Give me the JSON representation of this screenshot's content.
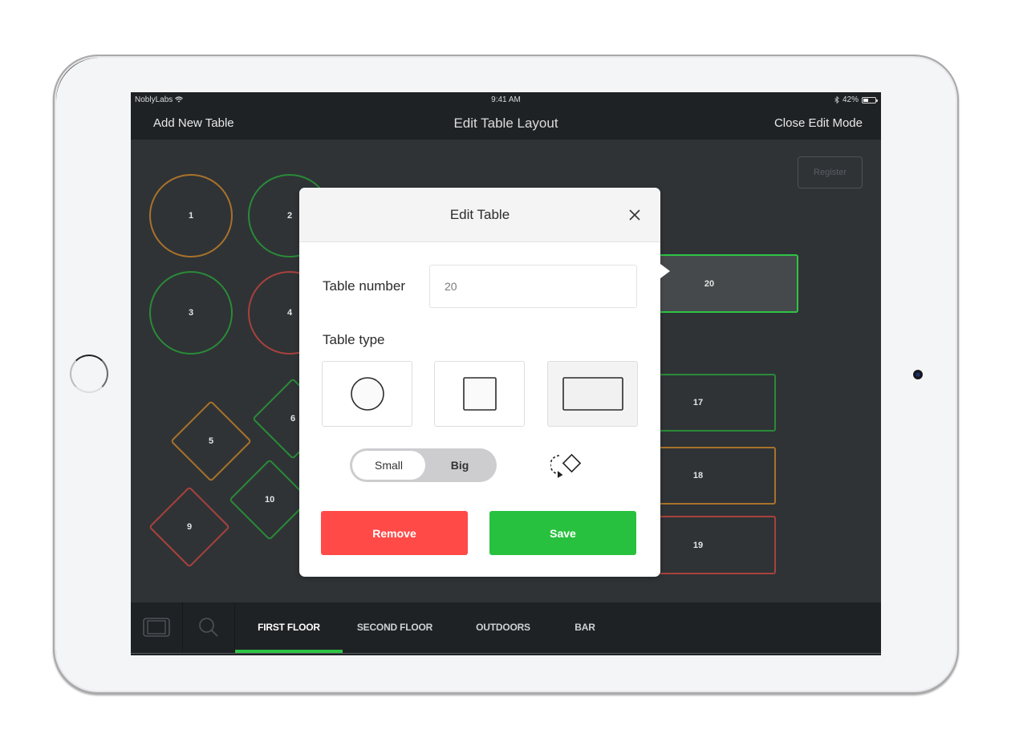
{
  "status_bar": {
    "carrier": "NoblyLabs",
    "time": "9:41 AM",
    "battery_percent_label": "42%",
    "battery_level": 0.42
  },
  "nav": {
    "left_label": "Add New Table",
    "title": "Edit Table Layout",
    "right_label": "Close Edit Mode"
  },
  "floor": {
    "register_label": "Register",
    "tables": [
      {
        "number": "1",
        "shape": "round",
        "status": "orange"
      },
      {
        "number": "2",
        "shape": "round",
        "status": "green"
      },
      {
        "number": "3",
        "shape": "round",
        "status": "green"
      },
      {
        "number": "4",
        "shape": "round",
        "status": "red"
      },
      {
        "number": "5",
        "shape": "diamond",
        "status": "orange"
      },
      {
        "number": "6",
        "shape": "diamond",
        "status": "green"
      },
      {
        "number": "9",
        "shape": "diamond",
        "status": "red"
      },
      {
        "number": "10",
        "shape": "diamond",
        "status": "green"
      },
      {
        "number": "17",
        "shape": "rect",
        "status": "green"
      },
      {
        "number": "18",
        "shape": "rect",
        "status": "orange"
      },
      {
        "number": "19",
        "shape": "rect",
        "status": "red"
      },
      {
        "number": "20",
        "shape": "rect",
        "status": "selected"
      }
    ],
    "colors": {
      "orange": "#a8722a",
      "green": "#2a8a38",
      "red": "#a8413c",
      "selected": "#2ec445"
    }
  },
  "tabs": {
    "items": [
      {
        "label": "FIRST FLOOR",
        "active": true
      },
      {
        "label": "SECOND FLOOR",
        "active": false
      },
      {
        "label": "OUTDOORS",
        "active": false
      },
      {
        "label": "BAR",
        "active": false
      }
    ],
    "accent": "#2ec445"
  },
  "modal": {
    "title": "Edit Table",
    "table_number_label": "Table number",
    "table_number_value": "20",
    "table_type_label": "Table type",
    "table_types": [
      "round",
      "square",
      "rectangle"
    ],
    "selected_type": "rectangle",
    "size_options": [
      "Small",
      "Big"
    ],
    "selected_size": "Small",
    "remove_label": "Remove",
    "save_label": "Save",
    "remove_color": "#ff4a48",
    "save_color": "#28c13f"
  }
}
